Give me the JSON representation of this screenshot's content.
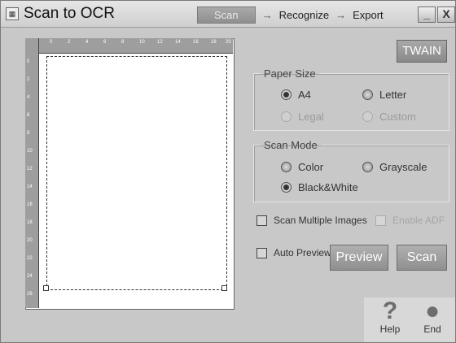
{
  "window": {
    "title": "Scan to OCR",
    "icon": "scanner-icon",
    "minimize_label": "_",
    "close_label": "X"
  },
  "steps": [
    {
      "label": "Scan",
      "active": true
    },
    {
      "label": "Recognize",
      "active": false
    },
    {
      "label": "Export",
      "active": false
    }
  ],
  "ruler": {
    "top_labels": [
      "0",
      "2",
      "4",
      "6",
      "8",
      "10",
      "12",
      "14",
      "16",
      "18",
      "20"
    ],
    "left_labels": [
      "0",
      "2",
      "4",
      "6",
      "8",
      "10",
      "12",
      "14",
      "16",
      "18",
      "20",
      "22",
      "24",
      "26",
      "28",
      "30"
    ]
  },
  "twain_button": "TWAIN",
  "paper_size": {
    "label": "Paper Size",
    "options": [
      {
        "label": "A4",
        "selected": true,
        "enabled": true
      },
      {
        "label": "Letter",
        "selected": false,
        "enabled": true
      },
      {
        "label": "Legal",
        "selected": false,
        "enabled": false
      },
      {
        "label": "Custom",
        "selected": false,
        "enabled": false
      }
    ]
  },
  "scan_mode": {
    "label": "Scan Mode",
    "options": [
      {
        "label": "Color",
        "selected": false
      },
      {
        "label": "Grayscale",
        "selected": false
      },
      {
        "label": "Black&White",
        "selected": true
      }
    ]
  },
  "checkboxes": {
    "scan_multiple": "Scan Multiple Images",
    "enable_adf": "Enable ADF",
    "auto_preview": "Auto Preview"
  },
  "buttons": {
    "preview": "Preview",
    "scan": "Scan"
  },
  "tools": {
    "help": "Help",
    "end": "End"
  },
  "colors": {
    "button_gray": "#9a9a9a",
    "panel_bg": "#c8c8c8"
  }
}
